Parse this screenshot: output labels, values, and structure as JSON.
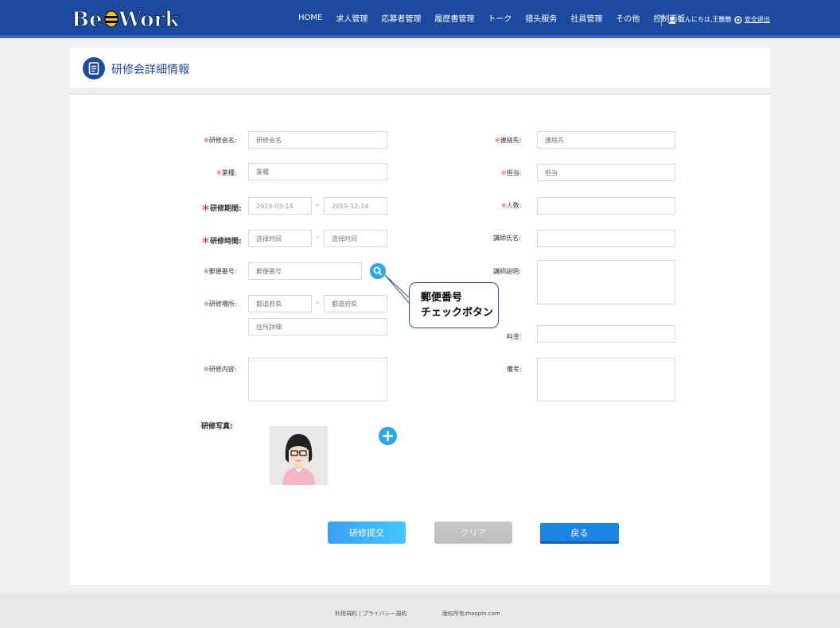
{
  "header": {
    "logo_text": "BeeWork",
    "nav": [
      "HOME",
      "求人管理",
      "応募者管理",
      "履歴書管理",
      "トーク",
      "猎头服务",
      "社員管理",
      "その他",
      "控制面板"
    ],
    "user_greeting": "こんにちは,王艷艷",
    "logout_label": "安全退出"
  },
  "page": {
    "title": "研修会詳細情報"
  },
  "form": {
    "required_mark": "※",
    "required_star": "＊",
    "left": {
      "seminar_name": {
        "label": "研修会名:",
        "placeholder": "研修会名"
      },
      "industry": {
        "label": "業種:",
        "placeholder": "業種"
      },
      "period": {
        "label": "研修期間:",
        "start": "2019-03-14",
        "end": "2019-12-14"
      },
      "time": {
        "label": "研修時間:",
        "start_placeholder": "选择时间",
        "end_placeholder": "选择时间"
      },
      "postal": {
        "label": "郵便番号:",
        "placeholder": "郵便番号"
      },
      "place": {
        "label": "研修場所:",
        "pref_placeholder": "都道府県",
        "pref2_placeholder": "都道府県",
        "address_placeholder": "住所詳細"
      },
      "content": {
        "label": "研修内容:"
      },
      "photo": {
        "label": "研修写真:"
      }
    },
    "right": {
      "contact": {
        "label": "連絡先:",
        "placeholder": "連絡先"
      },
      "charge": {
        "label": "担当:",
        "placeholder": "担当"
      },
      "headcount": {
        "label": "人数:"
      },
      "lecturer_name": {
        "label": "講師氏名:"
      },
      "lecturer_desc": {
        "label": "講師説明:"
      },
      "fee": {
        "label": "料金:"
      },
      "remarks": {
        "label": "備考:"
      }
    },
    "dash": "-"
  },
  "callout": {
    "line1": "郵便番号",
    "line2": "チェックボタン"
  },
  "buttons": {
    "submit": "研修提交",
    "clear": "クリア",
    "back": "戻る"
  },
  "footer": {
    "links": "利用規約 | プライバシー規約",
    "copyright": "版权所有zhaopin.com"
  },
  "colors": {
    "brand": "#1b4aa0",
    "accent": "#2aa7e8",
    "required": "#e4393c"
  }
}
